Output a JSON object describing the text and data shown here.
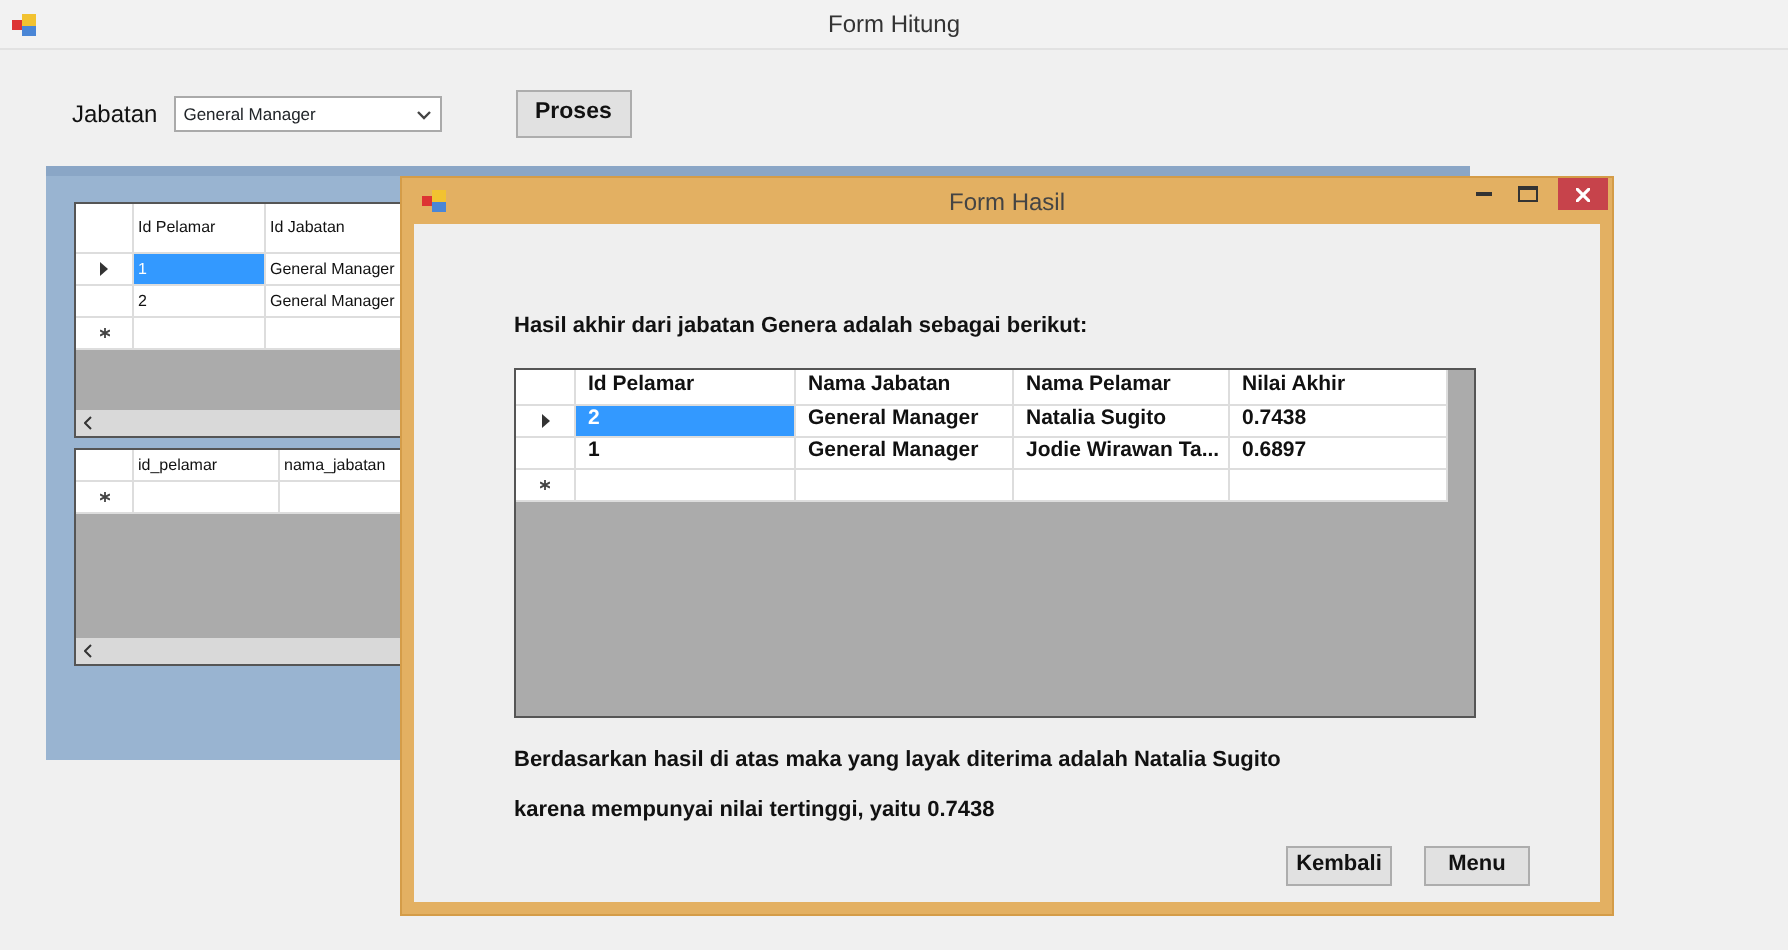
{
  "main_window": {
    "title": "Form Hitung",
    "jabatan_label": "Jabatan",
    "jabatan_value": "General Manager",
    "proses_button": "Proses",
    "grid_1": {
      "columns": [
        "Id Pelamar",
        "Id Jabatan"
      ],
      "rows": [
        {
          "cells": [
            "1",
            "General Manager"
          ],
          "current": true,
          "selected": true
        },
        {
          "cells": [
            "2",
            "General Manager"
          ],
          "current": false,
          "selected": false
        }
      ],
      "new_row": true
    },
    "grid_2": {
      "columns": [
        "id_pelamar",
        "nama_jabatan"
      ],
      "new_row": true
    }
  },
  "dialog": {
    "title": "Form Hasil",
    "intro_text": "Hasil akhir dari jabatan  Genera adalah sebagai berikut:",
    "grid": {
      "columns": [
        "Id Pelamar",
        "Nama Jabatan",
        "Nama Pelamar",
        "Nilai Akhir"
      ],
      "rows": [
        {
          "cells": [
            "2",
            "General Manager",
            "Natalia Sugito",
            "0.7438"
          ],
          "current": true,
          "selected": true
        },
        {
          "cells": [
            "1",
            "General Manager",
            "Jodie Wirawan Ta...",
            "0.6897"
          ],
          "current": false,
          "selected": false
        }
      ],
      "new_row": true
    },
    "conclusion_text": "Berdasarkan hasil di atas maka yang layak diterima adalah  Natalia Sugito",
    "reason_text": "karena mempunyai nilai tertinggi, yaitu  0.7438",
    "buttons": [
      "Kembali",
      "Menu"
    ]
  }
}
